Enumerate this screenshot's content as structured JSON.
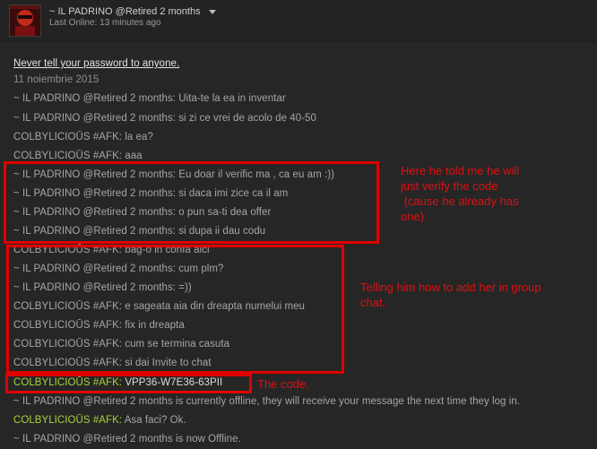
{
  "header": {
    "friend_name": "~ IL PADRINO @Retired 2 months",
    "last_online": "Last Online: 13 minutes ago"
  },
  "chat": {
    "warning": "Never tell your password to anyone.",
    "date": "11 noiembrie 2015",
    "messages": [
      "~ IL PADRINO @Retired 2 months: Uita-te la ea in inventar",
      "~ IL PADRINO @Retired 2 months: si zi ce vrei de acolo de 40-50",
      "COLBYLICIOŪS #AFK: la ea?",
      "COLBYLICIOŪS #AFK: aaa",
      "~ IL PADRINO @Retired 2 months: Eu doar il verific ma , ca eu am :))",
      "~ IL PADRINO @Retired 2 months: si daca imi zice ca il am",
      "~ IL PADRINO @Retired 2 months: o pun sa-ti dea offer",
      "~ IL PADRINO @Retired 2 months: si dupa ii dau codu",
      "COLBYLICIOŪS #AFK: bag-o in confa aici",
      "~ IL PADRINO @Retired 2 months: cum plm?",
      "~ IL PADRINO @Retired 2 months: =))",
      "COLBYLICIOŪS #AFK: e sageata aia din dreapta numelui meu",
      "COLBYLICIOŪS #AFK: fix in dreapta",
      "COLBYLICIOŪS #AFK: cum se termina casuta",
      "COLBYLICIOŪS #AFK: si dai Invite to chat"
    ],
    "code_name": "COLBYLICIOŪS #AFK:",
    "code_value": "VPP36-W7E36-63PII",
    "offline_notice": "~ IL PADRINO @Retired 2 months is currently offline, they will receive your message the next time they log in.",
    "self_name": "COLBYLICIOŪS #AFK:",
    "self_text": "Asa faci? Ok.",
    "now_offline": "~ IL PADRINO @Retired 2 months is now Offline."
  },
  "annotations": {
    "note1_lines": [
      "Here he told me he will",
      "just verify the code",
      " (cause he already has",
      "one)"
    ],
    "note2_lines": [
      "Telling him how to add her in group",
      "chat."
    ],
    "note3": "The code."
  },
  "colors": {
    "background": "#262626",
    "text": "#a6a6a6",
    "green_name": "#a4d438",
    "annotation_red": "#e10000"
  }
}
